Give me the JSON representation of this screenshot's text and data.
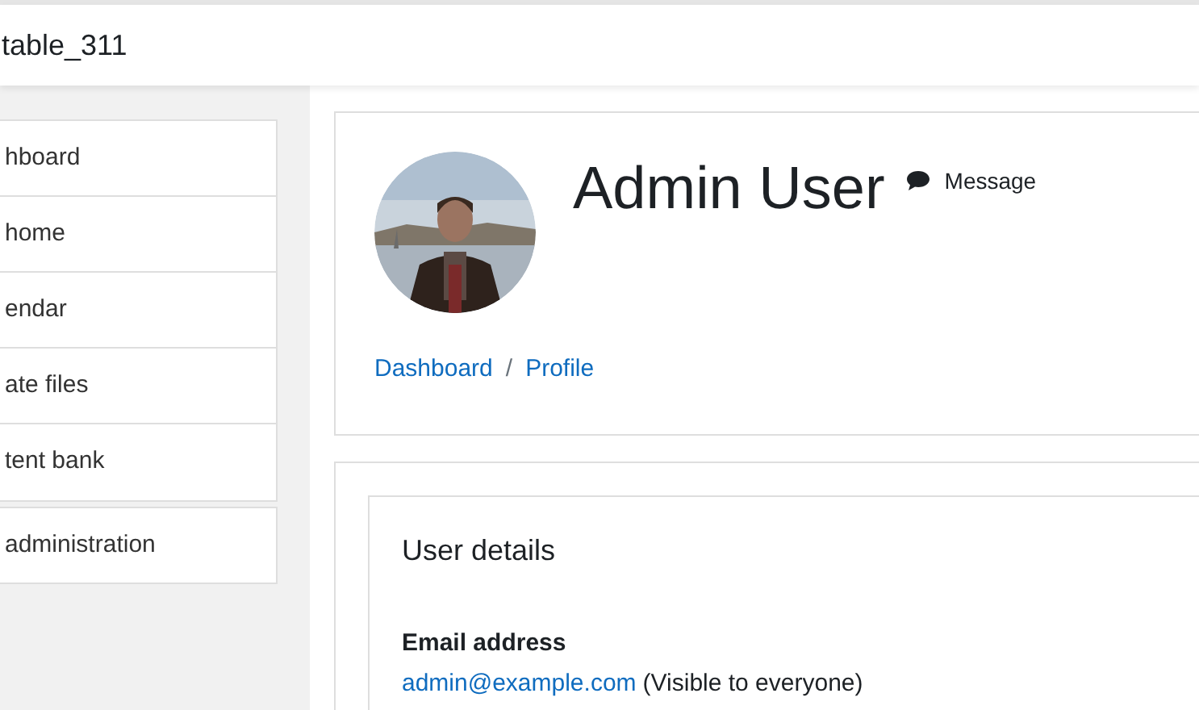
{
  "navbar": {
    "site_name": "table_311"
  },
  "sidebar": {
    "items": [
      {
        "label": "hboard"
      },
      {
        "label": "home"
      },
      {
        "label": "endar"
      },
      {
        "label": "ate files"
      },
      {
        "label": "tent bank"
      }
    ],
    "admin_item": {
      "label": "administration"
    }
  },
  "profile_header": {
    "name": "Admin User",
    "message_link": "Message",
    "breadcrumb": [
      "Dashboard",
      "Profile"
    ],
    "breadcrumb_separator": "/"
  },
  "user_details": {
    "title": "User details",
    "fields": [
      {
        "label": "Email address",
        "value": "admin@example.com",
        "note": "(Visible to everyone)"
      }
    ]
  }
}
